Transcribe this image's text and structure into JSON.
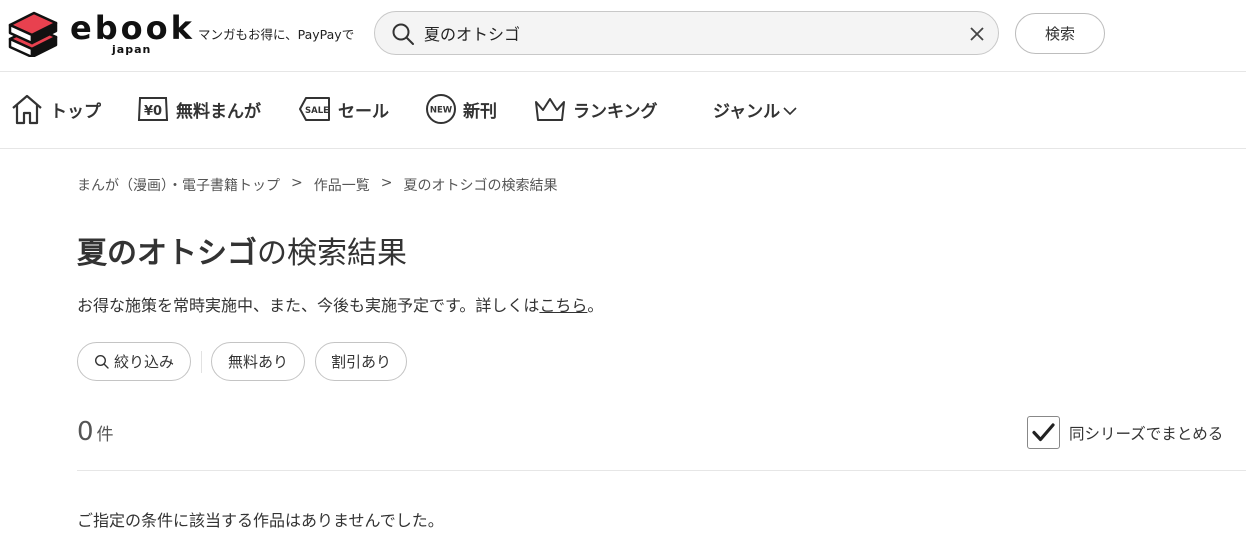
{
  "header": {
    "logo_text": "ebook",
    "logo_sub": "japan",
    "tagline": "マンガもお得に、PayPayで",
    "search": {
      "value": "夏のオトシゴ",
      "placeholder": ""
    },
    "search_button_label": "検索"
  },
  "nav": {
    "items": [
      {
        "label": "トップ",
        "icon": "home-icon"
      },
      {
        "label": "無料まんが",
        "icon": "yen-zero-icon"
      },
      {
        "label": "セール",
        "icon": "sale-tag-icon"
      },
      {
        "label": "新刊",
        "icon": "new-badge-icon"
      },
      {
        "label": "ランキング",
        "icon": "crown-icon"
      },
      {
        "label": "ジャンル",
        "icon": "chevron-down-icon"
      }
    ],
    "sale_icon_text": "SALE",
    "new_icon_text": "NEW",
    "yen_icon_text": "¥0"
  },
  "breadcrumb": [
    "まんが（漫画）・電子書籍トップ",
    "作品一覧",
    "夏のオトシゴの検索結果"
  ],
  "breadcrumb_separator": ">",
  "title": {
    "keyword": "夏のオトシゴ",
    "suffix": "の検索結果"
  },
  "notice": {
    "text": "お得な施策を常時実施中、また、今後も実施予定です。詳しくは",
    "link": "こちら",
    "end": "。"
  },
  "filters": {
    "narrow": "絞り込み",
    "free": "無料あり",
    "discount": "割引あり"
  },
  "results": {
    "count": "0",
    "unit": "件",
    "group_series_label": "同シリーズでまとめる",
    "group_series_checked": true
  },
  "empty_message": "ご指定の条件に該当する作品はありませんでした。",
  "colors": {
    "logo_red": "#e8414f",
    "text": "#333333",
    "border": "#c4c4c4"
  }
}
